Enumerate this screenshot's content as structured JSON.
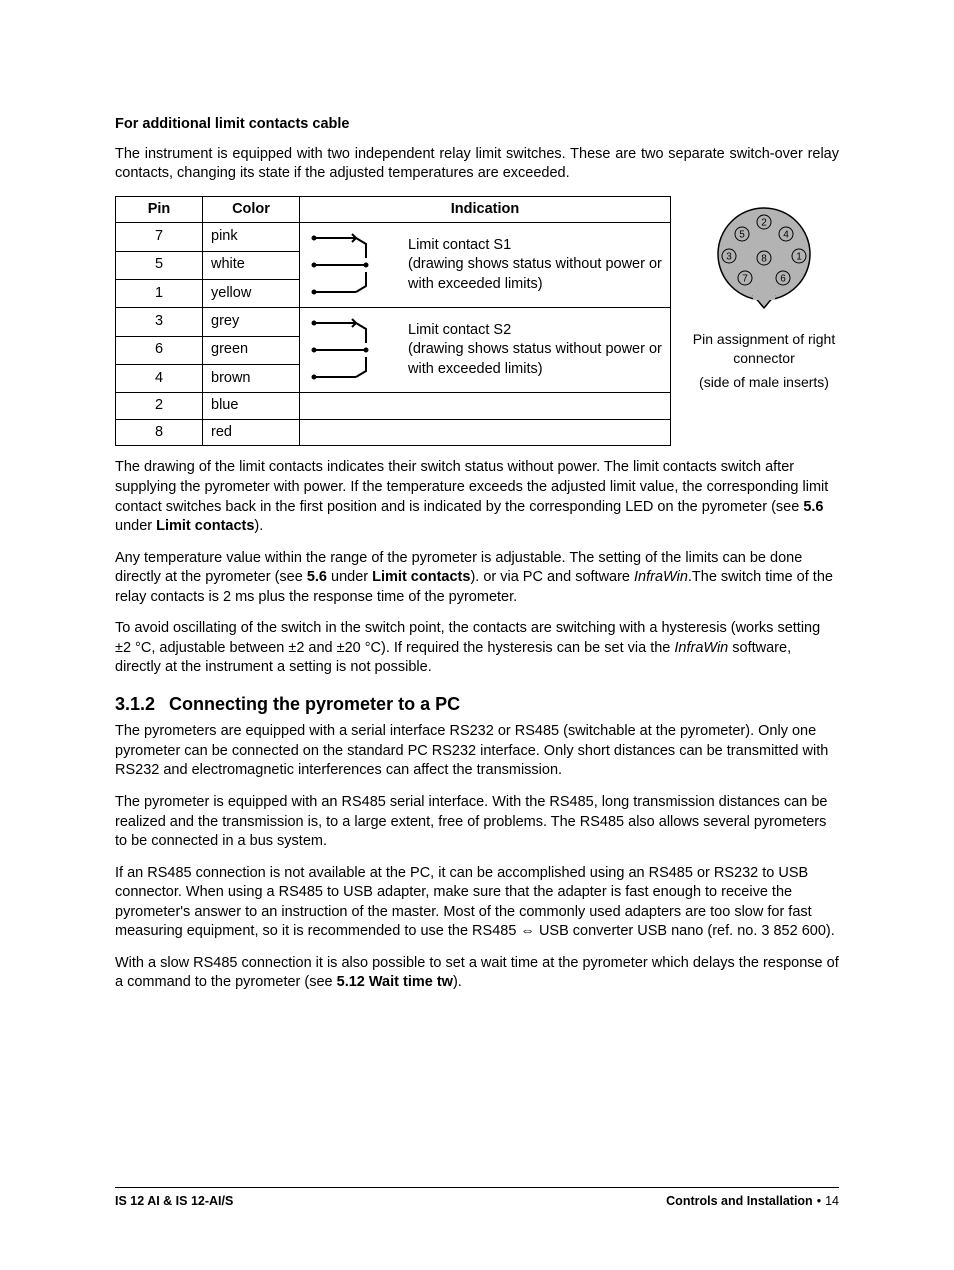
{
  "heading1": "For additional limit contacts cable",
  "intro": "The instrument is equipped with two independent relay limit switches. These are two separate switch-over relay contacts, changing its state if the adjusted temperatures are exceeded.",
  "table": {
    "headers": {
      "pin": "Pin",
      "color": "Color",
      "indication": "Indication"
    },
    "rows": [
      {
        "pin": "7",
        "color": "pink"
      },
      {
        "pin": "5",
        "color": "white"
      },
      {
        "pin": "1",
        "color": "yellow"
      },
      {
        "pin": "3",
        "color": "grey"
      },
      {
        "pin": "6",
        "color": "green"
      },
      {
        "pin": "4",
        "color": "brown"
      },
      {
        "pin": "2",
        "color": "blue"
      },
      {
        "pin": "8",
        "color": "red"
      }
    ],
    "ind1": {
      "title": "Limit contact S1",
      "sub": "(drawing shows status without power or with exceeded limits)"
    },
    "ind2": {
      "title": "Limit contact S2",
      "sub": "(drawing shows status without power or with exceeded limits)"
    }
  },
  "connector": {
    "caption1": "Pin assignment of right connector",
    "caption2": "(side of male inserts)",
    "pins": [
      "1",
      "2",
      "3",
      "4",
      "5",
      "6",
      "7",
      "8"
    ]
  },
  "para_draw": {
    "p1a": "The drawing of the limit contacts indicates their switch status without power. The limit contacts switch after supplying the pyrometer with power. If the temperature exceeds the adjusted limit value, the corresponding limit contact switches back in the first position and is indicated by the corresponding LED on the pyrometer (see ",
    "ref1": "5.6",
    "mid1": " under ",
    "ref1b": "Limit contacts",
    "end1": ")."
  },
  "para_any": {
    "a": "Any temperature value within the range of the pyrometer is adjustable. The setting of the limits can be done directly at the pyrometer (see ",
    "ref": "5.6",
    "mid": " under ",
    "refb": "Limit contacts",
    "b": "). or via PC and software ",
    "infrawin": "InfraWin",
    "c": ".The switch time of the relay contacts is 2 ms plus the response time of the pyrometer."
  },
  "para_hys": {
    "a": "To avoid oscillating of the switch in the switch point, the contacts are switching with a hysteresis (works setting ±2 °C, adjustable between ±2 and ±20 °C).  If required the hysteresis can be set via the ",
    "iw": "InfraWin",
    "b": " software, directly at the instrument a setting is not possible."
  },
  "section": {
    "num": "3.1.2",
    "title": "Connecting the pyrometer to a PC"
  },
  "p_pc1": "The pyrometers are equipped with a serial interface RS232 or RS485 (switchable at the pyrometer). Only one pyrometer can be connected on the standard PC RS232 interface. Only short distances can be transmitted with RS232 and electromagnetic interferences can affect the transmission.",
  "p_pc2": "The pyrometer is equipped with an RS485 serial interface. With the RS485, long transmission distances can be realized and the transmission is, to a large extent, free of problems. The RS485 also allows several pyrometers to be connected in a bus system.",
  "p_pc3": "If an RS485 connection is not available at the PC, it can be accomplished using an RS485 or RS232 to USB connector. When using a RS485 to USB adapter, make sure that the adapter is fast enough to receive the pyrometer's answer to an instruction of the master. Most of the commonly used adapters are too slow for fast measuring equipment, so it is recommended to use the RS485 ⇔ USB converter USB nano (ref. no. 3 852 600).",
  "p_pc4": {
    "a": "With a slow RS485 connection it is also possible to set a wait time at the pyrometer which delays the response of a command to the pyrometer (see ",
    "ref": "5.12 Wait time tw",
    "b": ")."
  },
  "footer": {
    "left": "IS 12 AI & IS 12-AI/S",
    "right": "Controls and Installation",
    "page": "14"
  }
}
